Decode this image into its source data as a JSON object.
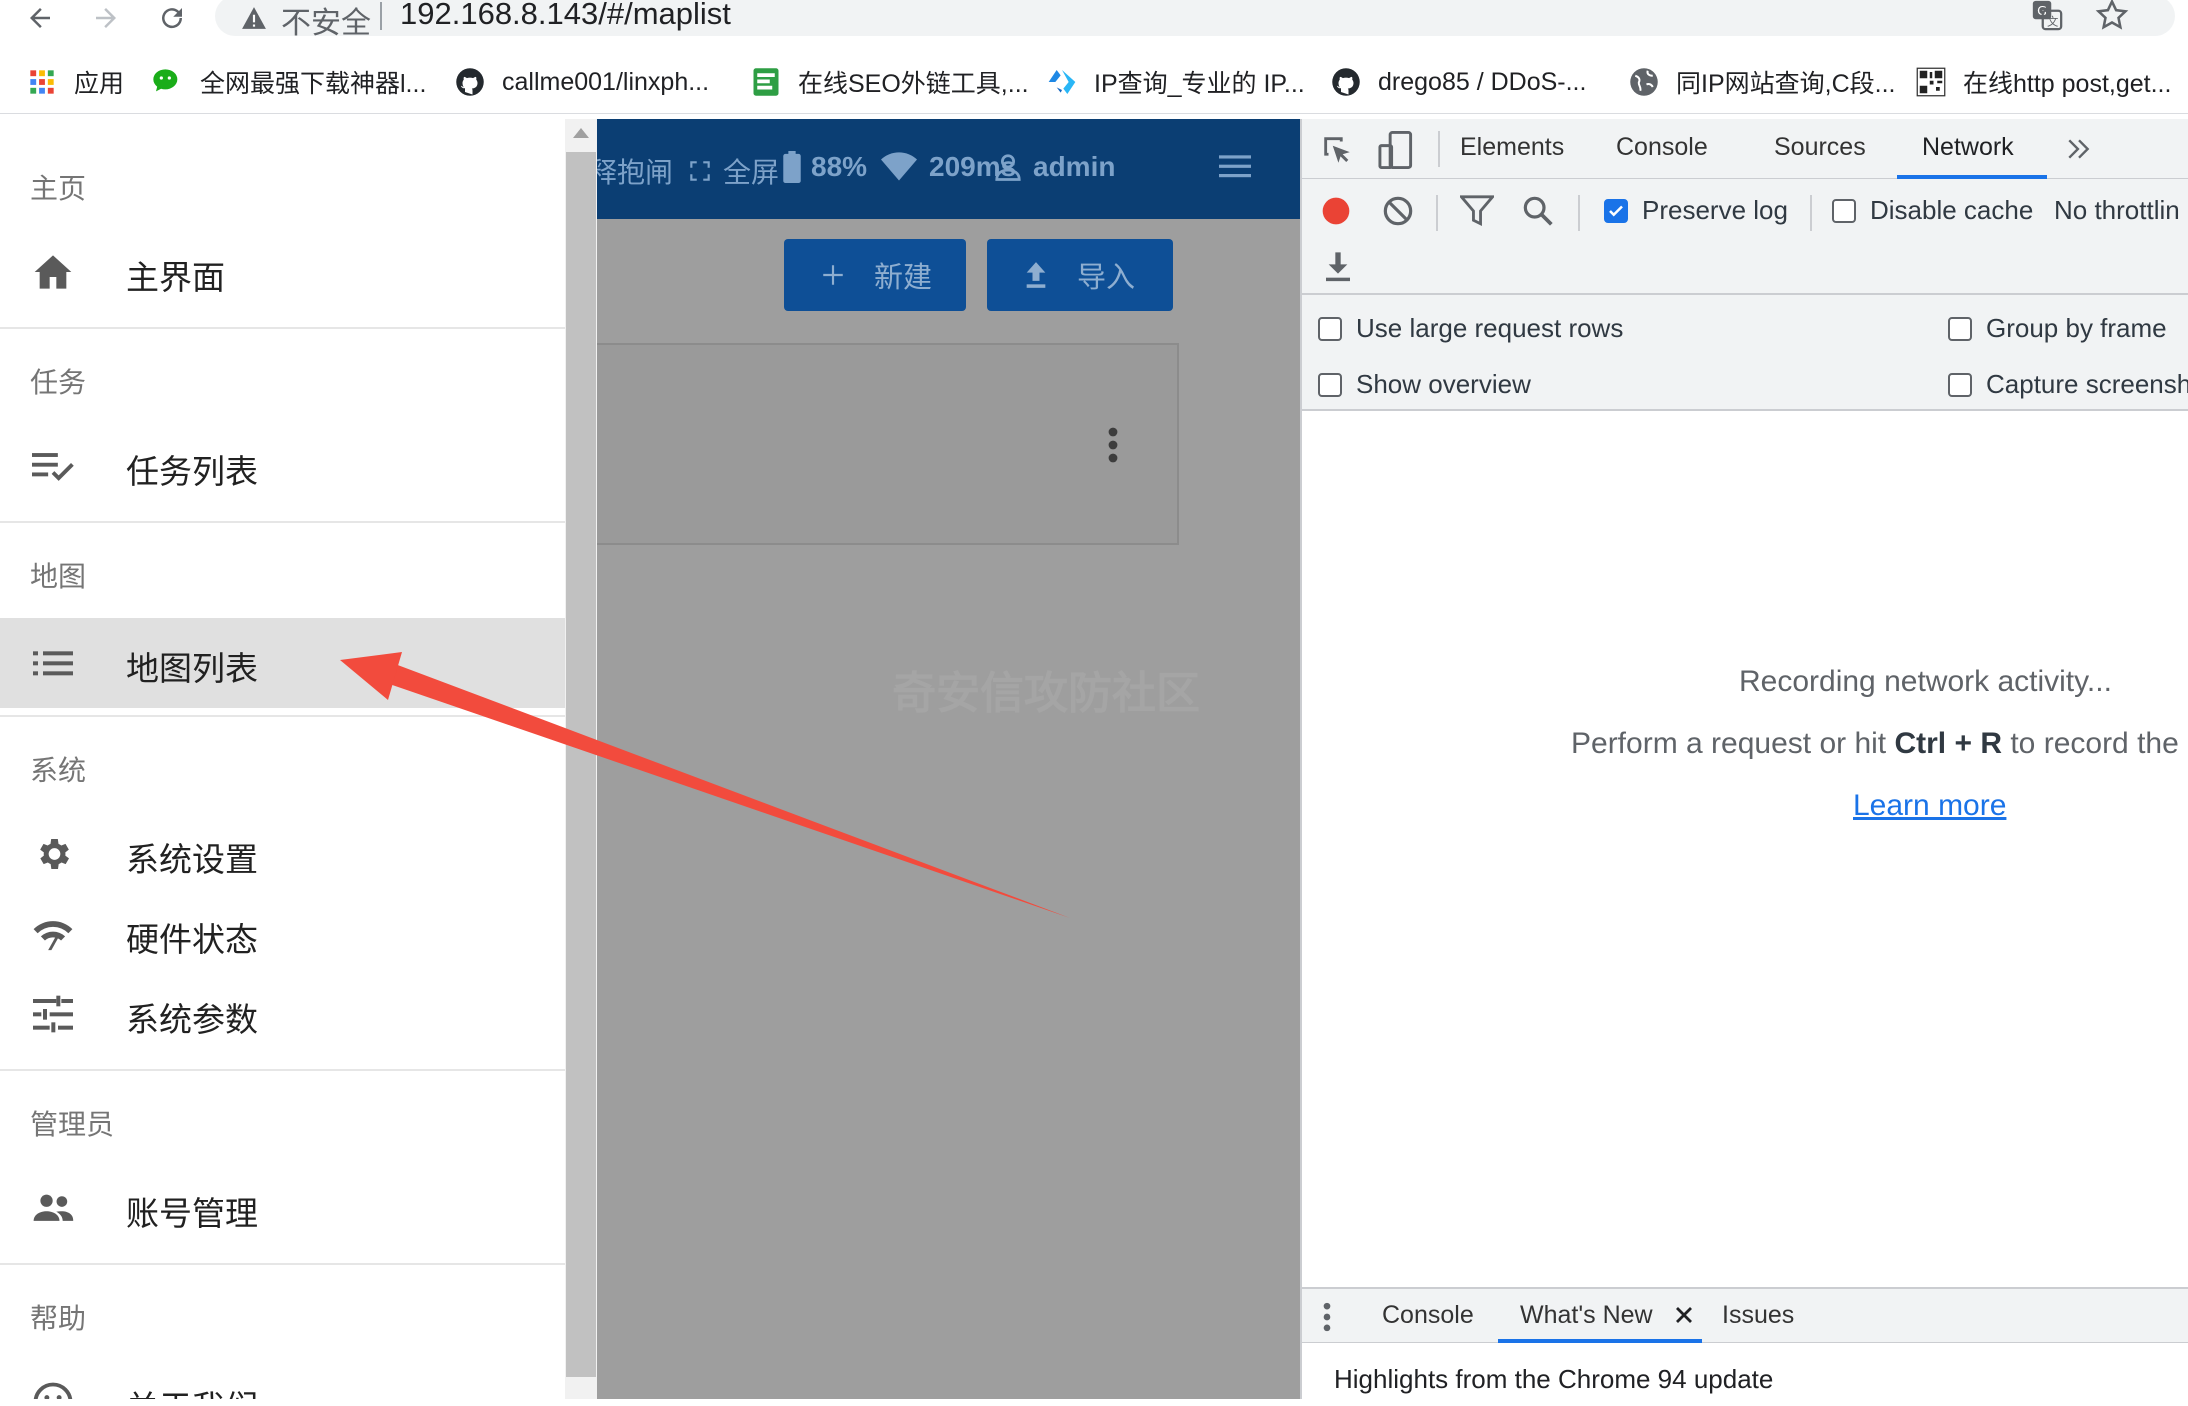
{
  "browser": {
    "insecure_label": "不安全",
    "url": "192.168.8.143/#/maplist"
  },
  "bookmarks": [
    {
      "label": "应用",
      "icon": "apps-grid-icon"
    },
    {
      "label": "全网最强下载神器l...",
      "icon": "wechat-icon"
    },
    {
      "label": "callme001/linxph...",
      "icon": "github-icon"
    },
    {
      "label": "在线SEO外链工具,...",
      "icon": "seo-tool-icon"
    },
    {
      "label": "IP查询_专业的 IP...",
      "icon": "ip-lookup-icon"
    },
    {
      "label": "drego85 / DDoS-...",
      "icon": "github-icon"
    },
    {
      "label": "同IP网站查询,C段...",
      "icon": "globe-icon"
    },
    {
      "label": "在线http post,get...",
      "icon": "qr-code-icon"
    }
  ],
  "drawer": {
    "sections": [
      {
        "header": "主页",
        "items": [
          {
            "label": "主界面",
            "icon": "home-icon"
          }
        ]
      },
      {
        "header": "任务",
        "items": [
          {
            "label": "任务列表",
            "icon": "playlist-check-icon"
          }
        ]
      },
      {
        "header": "地图",
        "items": [
          {
            "label": "地图列表",
            "icon": "list-icon",
            "active": true
          }
        ]
      },
      {
        "header": "系统",
        "items": [
          {
            "label": "系统设置",
            "icon": "gear-icon"
          },
          {
            "label": "硬件状态",
            "icon": "signal-icon"
          },
          {
            "label": "系统参数",
            "icon": "tune-icon"
          }
        ]
      },
      {
        "header": "管理员",
        "items": [
          {
            "label": "账号管理",
            "icon": "people-icon"
          }
        ]
      },
      {
        "header": "帮助",
        "items": [
          {
            "label": "关于我们",
            "icon": "smile-icon"
          }
        ]
      }
    ]
  },
  "app": {
    "appbar": {
      "brake_label": "释抱闸",
      "fullscreen_label": "全屏",
      "battery": "88%",
      "latency": "209ms",
      "user": "admin"
    },
    "new_button": "新建",
    "import_button": "导入",
    "watermark": "奇安信攻防社区"
  },
  "devtools": {
    "tabs": [
      "Elements",
      "Console",
      "Sources",
      "Network"
    ],
    "active_tab": "Network",
    "toolbar": {
      "preserve_log": "Preserve log",
      "disable_cache": "Disable cache",
      "throttling": "No throttlin"
    },
    "options": {
      "large_rows": "Use large request rows",
      "group_by_frame": "Group by frame",
      "show_overview": "Show overview",
      "capture_screenshots": "Capture screensh"
    },
    "empty": {
      "recording": "Recording network activity...",
      "perform_prefix": "Perform a request or hit ",
      "ctrl": "Ctrl",
      "plus": " + ",
      "r": "R",
      "perform_suffix": " to record the",
      "learn_more": "Learn more"
    },
    "drawer_tabs": [
      "Console",
      "What's New",
      "Issues"
    ],
    "highlights": "Highlights from the Chrome 94 update"
  },
  "colors": {
    "appbar": "#0b3e73",
    "button": "#0e4f96",
    "devtools_accent": "#1a73e8",
    "arrow": "#f24b3d"
  }
}
